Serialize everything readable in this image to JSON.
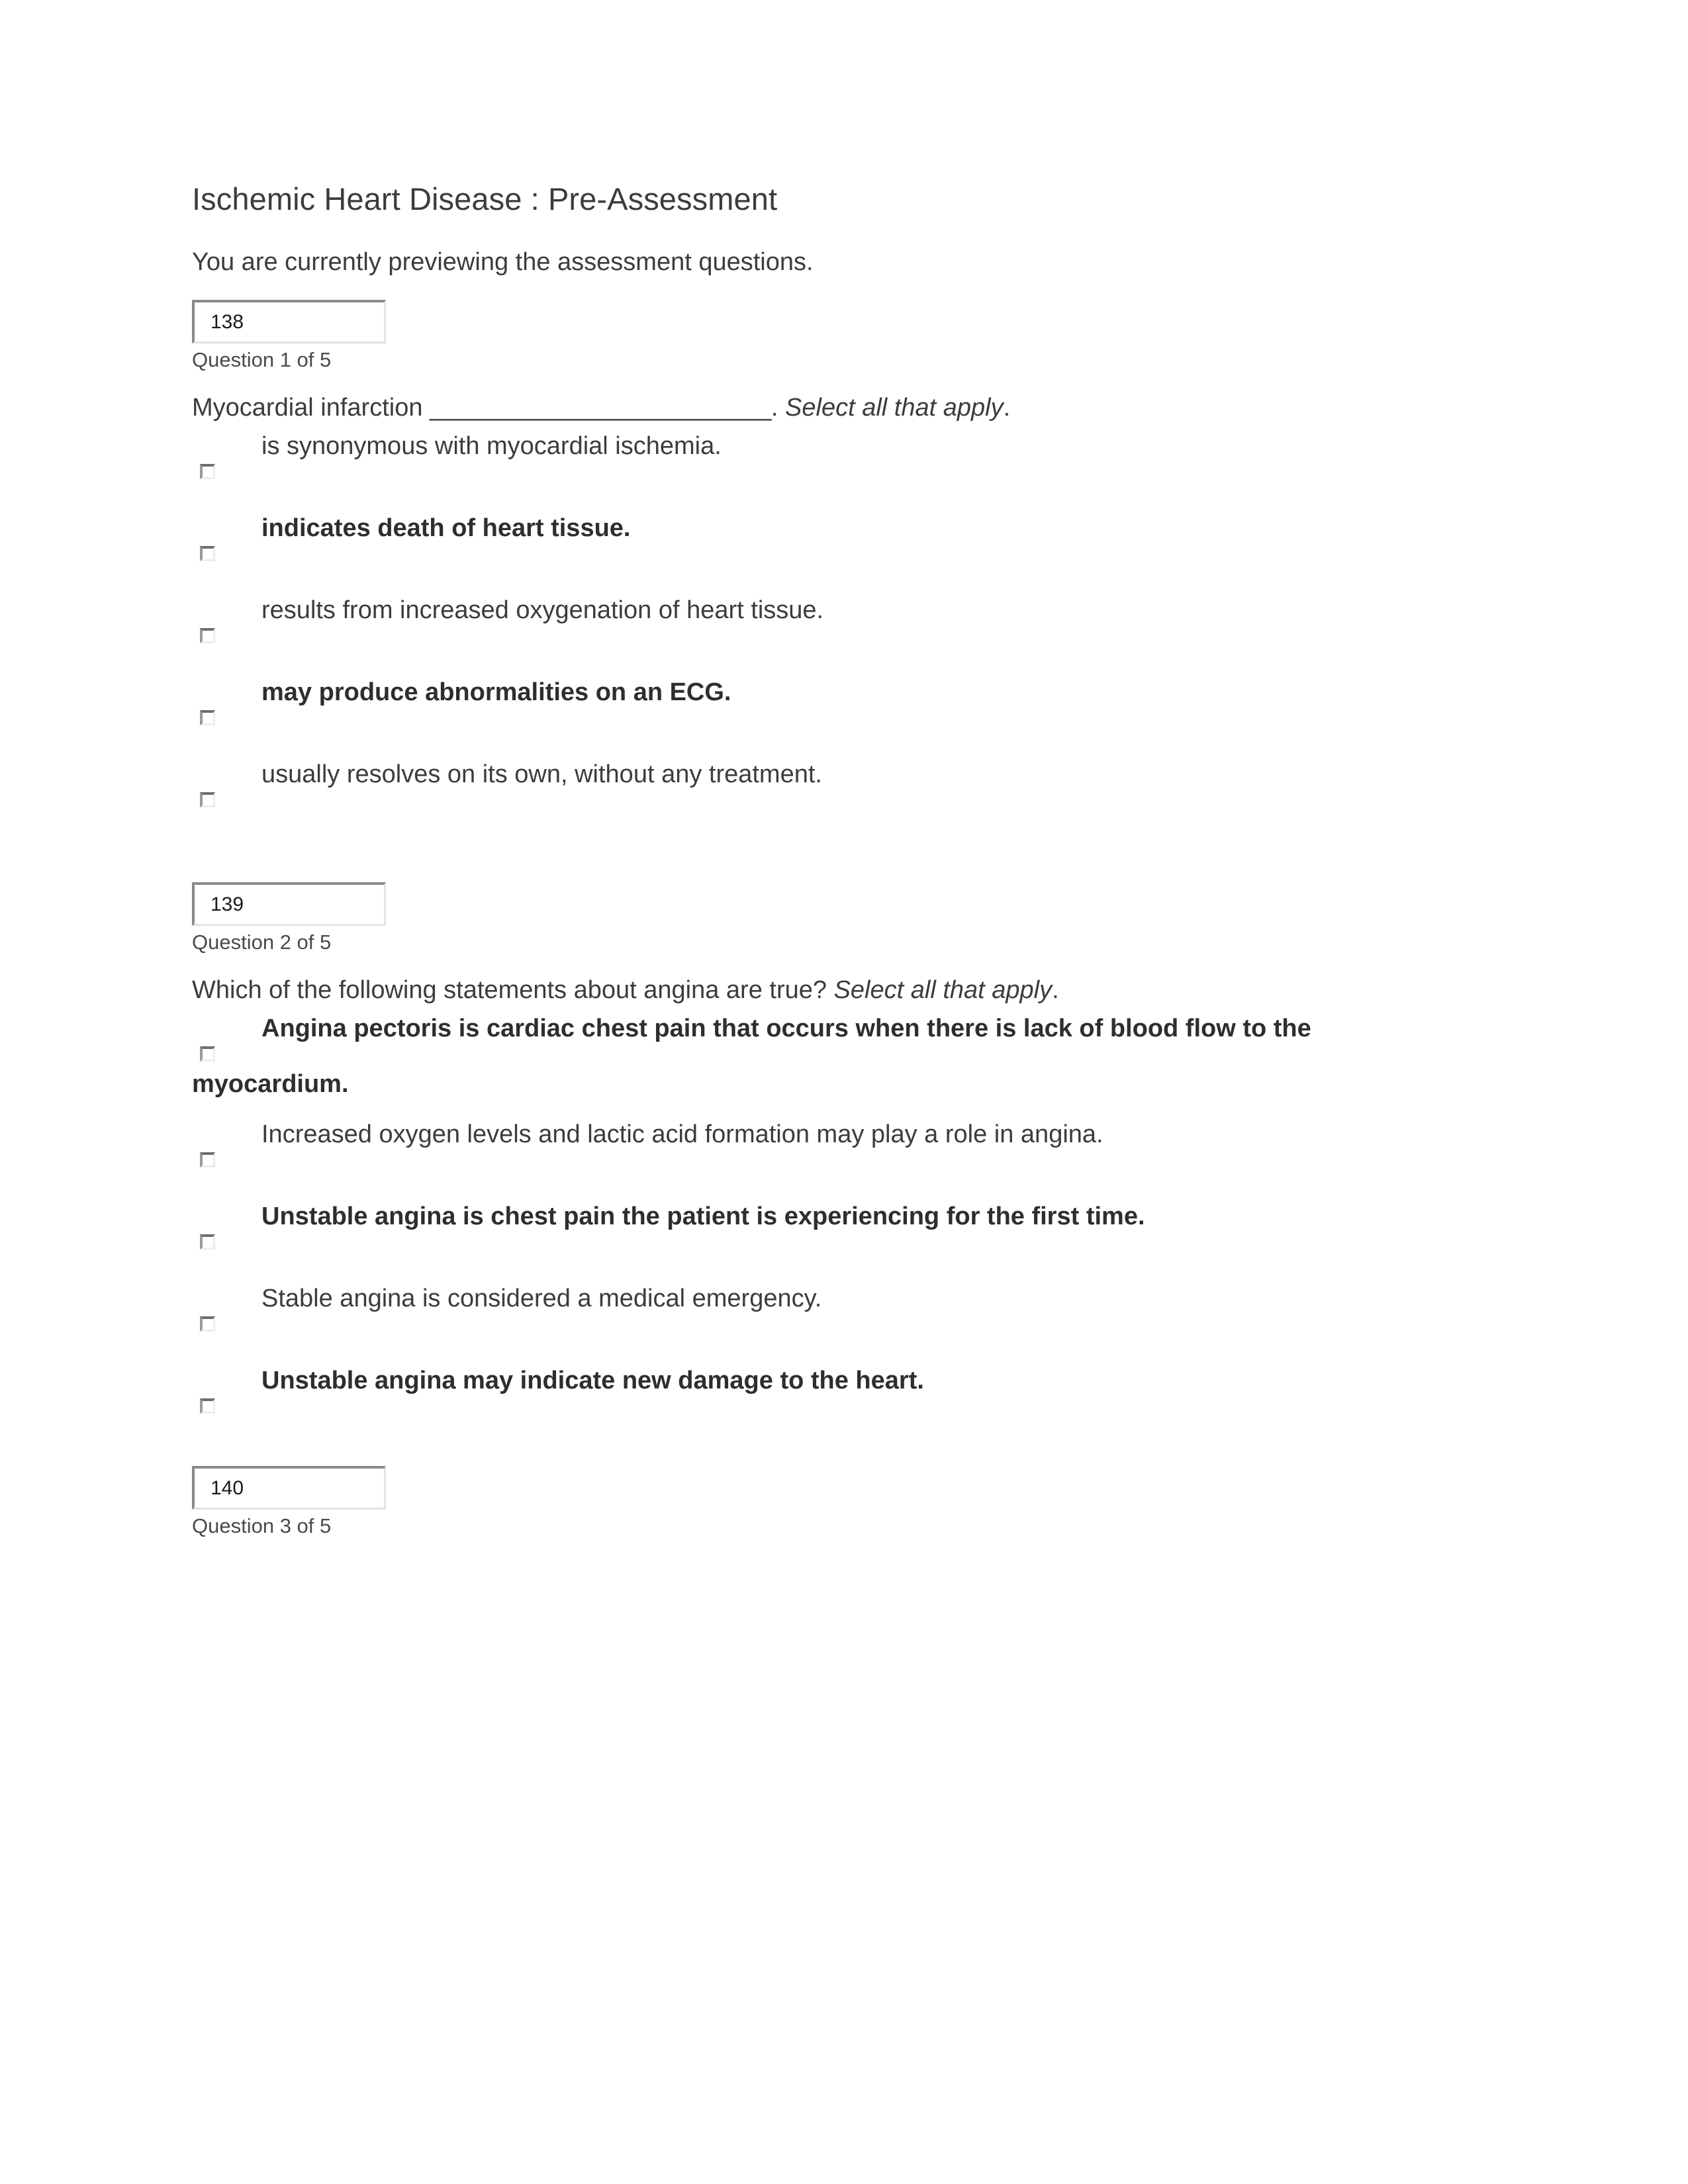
{
  "document": {
    "title": "Ischemic Heart Disease : Pre-Assessment",
    "preview_notice": "You are currently previewing the assessment questions."
  },
  "questions": [
    {
      "id_value": "138",
      "position_label": "Question 1 of 5",
      "stem_prefix": "Myocardial infarction ",
      "stem_blank": "_________________________",
      "stem_suffix": ". ",
      "stem_instruction": "Select all that apply",
      "stem_end": ".",
      "options": [
        {
          "text": "is synonymous with myocardial ischemia.",
          "bold": false,
          "checked": false
        },
        {
          "text": "indicates death of heart tissue.",
          "bold": true,
          "checked": false
        },
        {
          "text": "results from increased oxygenation of heart tissue.",
          "bold": false,
          "checked": false
        },
        {
          "text": "may produce abnormalities on an ECG.",
          "bold": true,
          "checked": false
        },
        {
          "text": "usually resolves on its own, without any treatment.",
          "bold": false,
          "checked": false
        }
      ]
    },
    {
      "id_value": "139",
      "position_label": "Question 2 of 5",
      "stem_prefix": "Which of the following statements about angina are true? ",
      "stem_blank": "",
      "stem_suffix": "",
      "stem_instruction": "Select all that apply",
      "stem_end": ".",
      "options": [
        {
          "text": "Angina pectoris is cardiac chest pain that occurs when there is lack of blood flow to the",
          "wrapped_text": "myocardium.",
          "bold": true,
          "checked": false
        },
        {
          "text": "Increased oxygen levels and lactic acid formation may play a role in angina.",
          "bold": false,
          "checked": false
        },
        {
          "text": "Unstable angina is chest pain the patient is experiencing for the first time.",
          "bold": true,
          "checked": false
        },
        {
          "text": "Stable angina is considered a medical emergency.",
          "bold": false,
          "checked": false
        },
        {
          "text": "Unstable angina may indicate new damage to the heart.",
          "bold": true,
          "checked": false
        }
      ]
    },
    {
      "id_value": "140",
      "position_label": "Question 3 of 5",
      "options": []
    }
  ]
}
